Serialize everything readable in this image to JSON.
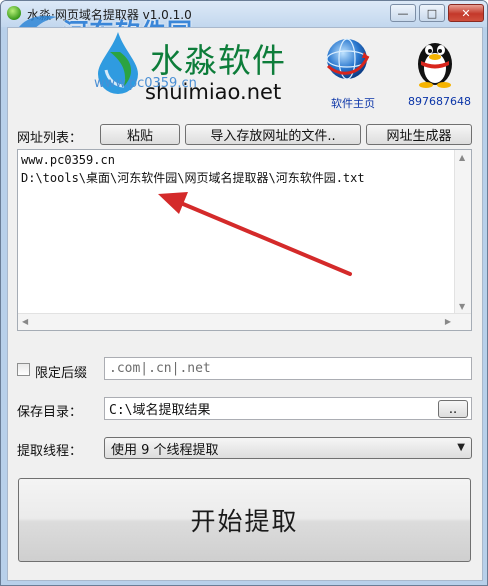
{
  "window": {
    "title": "水淼·网页域名提取器 v1.0.1.0",
    "controls": {
      "minimize": "—",
      "maximize": "□",
      "close": "✕"
    }
  },
  "watermark": {
    "site": "河东软件园",
    "url": "www.pc0359.cn"
  },
  "brand": {
    "name_cn": "水淼软件",
    "name_en": "shuimiao.net"
  },
  "header_links": {
    "homepage": "软件主页",
    "qq": "897687648"
  },
  "url_list": {
    "label": "网址列表：",
    "paste_button": "粘贴",
    "import_button": "导入存放网址的文件..",
    "generator_button": "网址生成器",
    "lines": [
      "www.pc0359.cn",
      "D:\\tools\\桌面\\河东软件园\\网页域名提取器\\河东软件园.txt"
    ]
  },
  "suffix_filter": {
    "label": "限定后缀",
    "checked": false,
    "placeholder": ".com|.cn|.net"
  },
  "save_dir": {
    "label": "保存目录：",
    "value": "C:\\域名提取结果",
    "browse_button": ".."
  },
  "threads": {
    "label": "提取线程：",
    "selected": "使用 9 个线程提取"
  },
  "start_button": "开始提取",
  "colors": {
    "brand_green": "#0d7d3a",
    "link_blue": "#0b35a8",
    "close_red": "#c4382a",
    "annotation_arrow": "#d42a2a"
  },
  "icons": {
    "app": "water-drop-icon",
    "homepage": "globe-icon",
    "qq": "qq-penguin-icon"
  }
}
